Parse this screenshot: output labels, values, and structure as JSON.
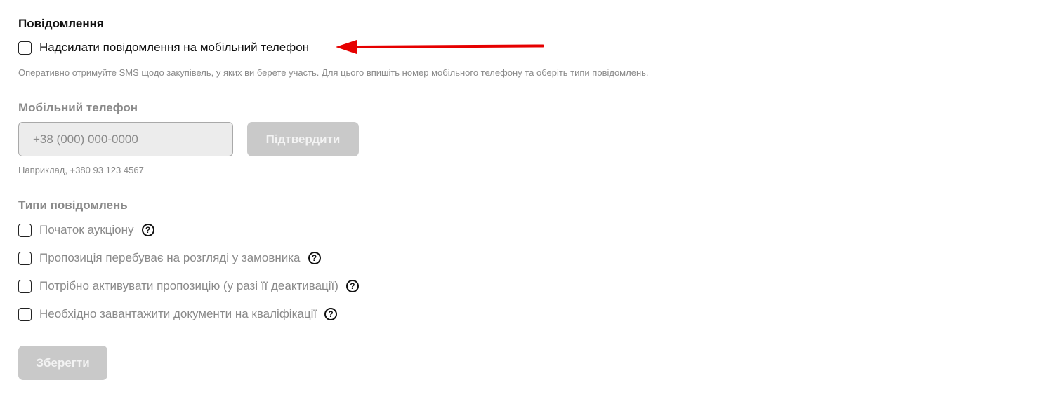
{
  "notifications": {
    "title": "Повідомлення",
    "sms_checkbox_label": "Надсилати повідомлення на мобільний телефон",
    "hint": "Оперативно отримуйте SMS щодо закупівель, у яких ви берете участь. Для цього впишіть номер мобільного телефону та оберіть типи повідомлень."
  },
  "phone": {
    "label": "Мобільний телефон",
    "placeholder": "+38 (000) 000-0000",
    "confirm_label": "Підтвердити",
    "example": "Наприклад, +380 93 123 4567"
  },
  "types": {
    "label": "Типи повідомлень",
    "items": [
      {
        "label": "Початок аукціону"
      },
      {
        "label": "Пропозиція перебуває на розгляді у замовника"
      },
      {
        "label": "Потрібно активувати пропозицію (у разі її деактивації)"
      },
      {
        "label": "Необхідно завантажити документи на кваліфікації"
      }
    ]
  },
  "save_label": "Зберегти",
  "icons": {
    "help": "question-circle-icon",
    "annotation": "red-arrow"
  },
  "colors": {
    "arrow": "#e60000",
    "disabled_button": "#c9c9c9",
    "muted_text": "#8a8a8a"
  }
}
